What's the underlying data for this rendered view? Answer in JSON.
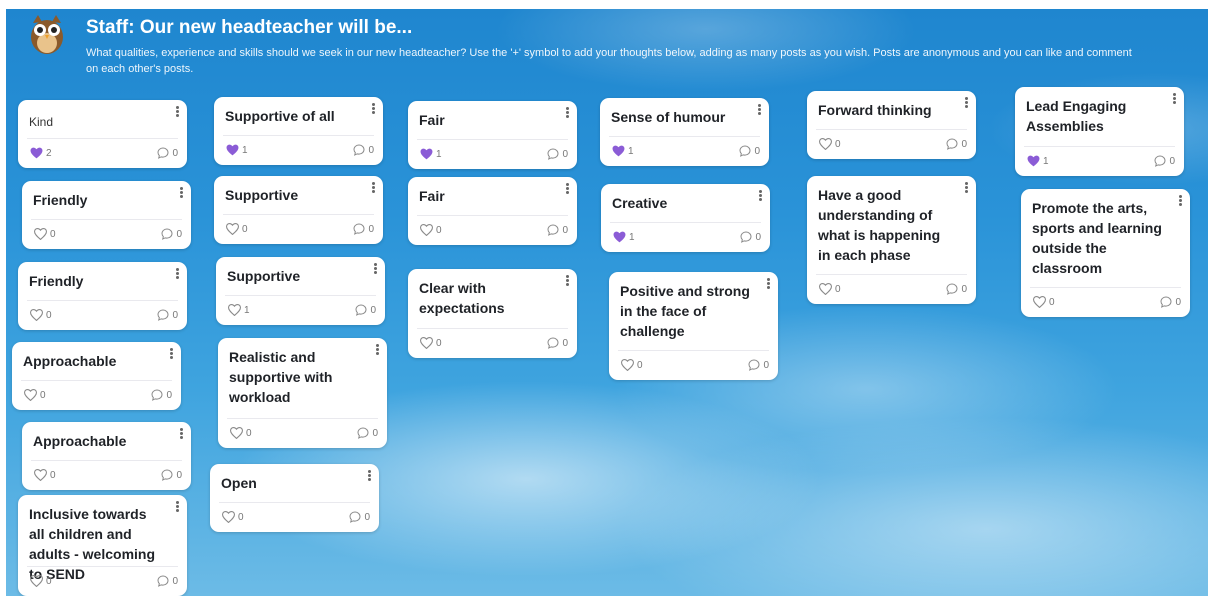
{
  "header": {
    "title": "Staff: Our new headteacher will be...",
    "subtitle": "What qualities, experience and skills should we seek in our new headteacher? Use the '+' symbol to add your thoughts below, adding as many posts as you wish. Posts are anonymous and you can like and comment on each other's posts."
  },
  "colors": {
    "like_filled": "#8b5cd6",
    "like_empty": "#8a8a8a",
    "card_bg": "#ffffff",
    "text": "#1f2227"
  },
  "posts": [
    {
      "text": "Kind",
      "likes": "2",
      "liked": true,
      "comments": "0"
    },
    {
      "text": "Friendly",
      "likes": "0",
      "liked": false,
      "comments": "0"
    },
    {
      "text": "Friendly",
      "likes": "0",
      "liked": false,
      "comments": "0"
    },
    {
      "text": "Approachable",
      "likes": "0",
      "liked": false,
      "comments": "0"
    },
    {
      "text": "Approachable",
      "likes": "0",
      "liked": false,
      "comments": "0"
    },
    {
      "text": "Inclusive towards all children and adults - welcoming to SEND",
      "likes": "0",
      "liked": false,
      "comments": "0"
    },
    {
      "text": "Supportive of all",
      "likes": "1",
      "liked": true,
      "comments": "0"
    },
    {
      "text": "Supportive",
      "likes": "0",
      "liked": false,
      "comments": "0"
    },
    {
      "text": "Supportive",
      "likes": "1",
      "liked": false,
      "comments": "0"
    },
    {
      "text": "Realistic and supportive with workload",
      "likes": "0",
      "liked": false,
      "comments": "0"
    },
    {
      "text": "Open",
      "likes": "0",
      "liked": false,
      "comments": "0"
    },
    {
      "text": "Fair",
      "likes": "1",
      "liked": true,
      "comments": "0"
    },
    {
      "text": "Fair",
      "likes": "0",
      "liked": false,
      "comments": "0"
    },
    {
      "text": "Clear with expectations",
      "likes": "0",
      "liked": false,
      "comments": "0"
    },
    {
      "text": "Sense of humour",
      "likes": "1",
      "liked": true,
      "comments": "0"
    },
    {
      "text": "Creative",
      "likes": "1",
      "liked": true,
      "comments": "0"
    },
    {
      "text": "Positive and strong in the face of challenge",
      "likes": "0",
      "liked": false,
      "comments": "0"
    },
    {
      "text": "Forward thinking",
      "likes": "0",
      "liked": false,
      "comments": "0"
    },
    {
      "text": "Have a good understanding of what is happening in each phase",
      "likes": "0",
      "liked": false,
      "comments": "0"
    },
    {
      "text": "Lead Engaging Assemblies",
      "likes": "1",
      "liked": true,
      "comments": "0"
    },
    {
      "text": "Promote the arts, sports and learning outside the classroom",
      "likes": "0",
      "liked": false,
      "comments": "0"
    }
  ]
}
